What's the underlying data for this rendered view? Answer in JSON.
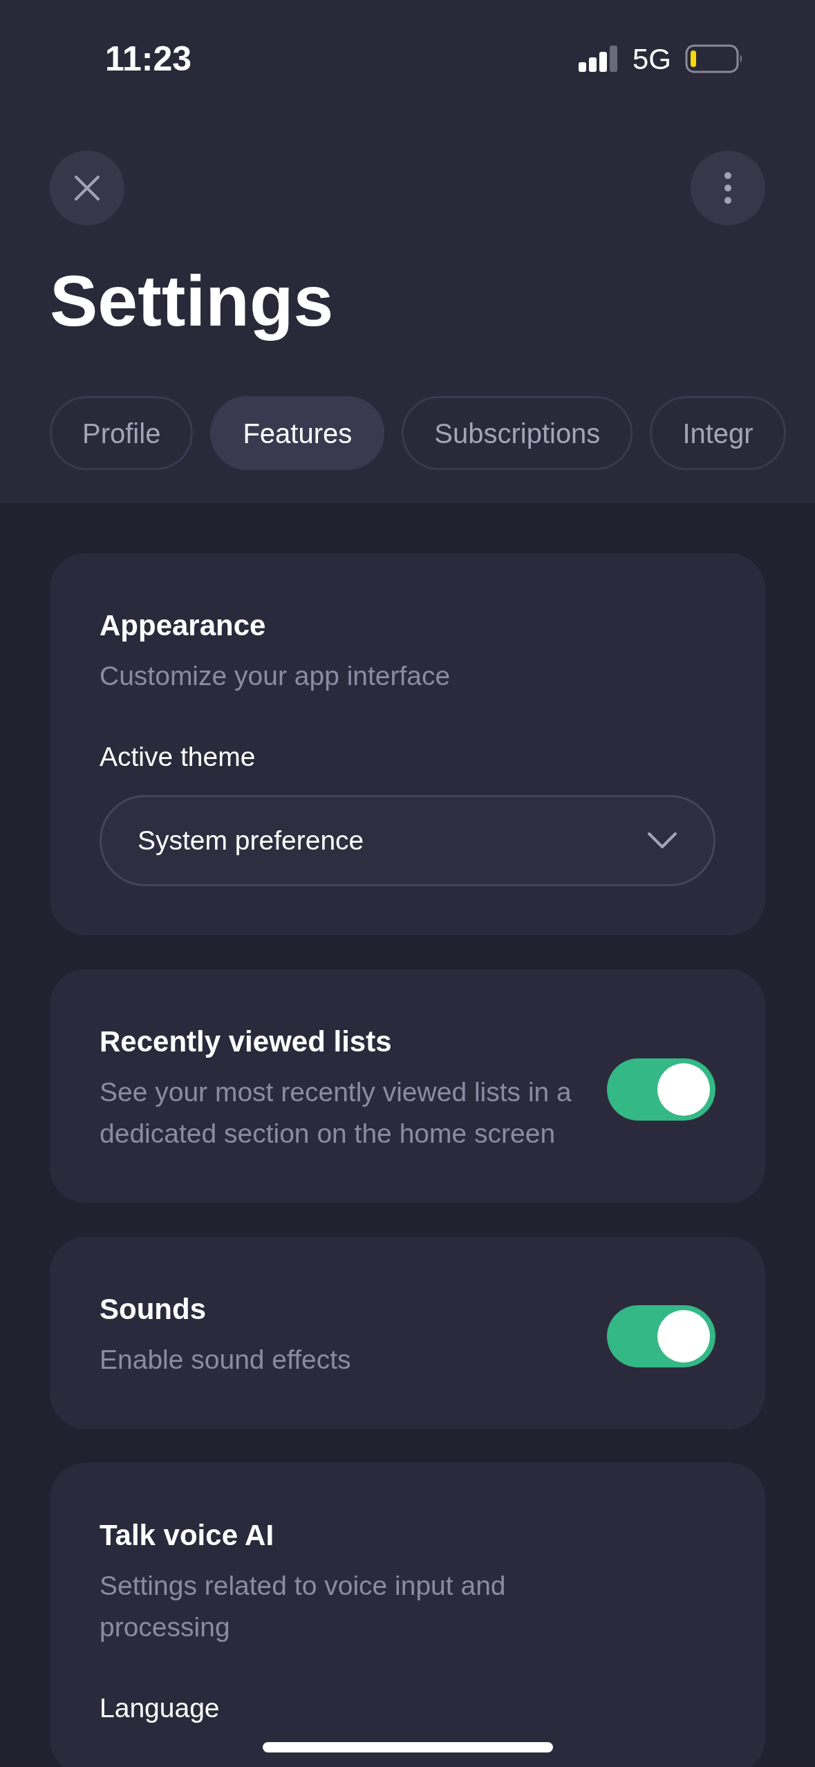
{
  "status_bar": {
    "time": "11:23",
    "network": "5G"
  },
  "header": {
    "title": "Settings"
  },
  "tabs": [
    {
      "label": "Profile",
      "selected": false
    },
    {
      "label": "Features",
      "selected": true
    },
    {
      "label": "Subscriptions",
      "selected": false
    },
    {
      "label": "Integr",
      "selected": false
    }
  ],
  "sections": [
    {
      "kind": "select",
      "title": "Appearance",
      "description": "Customize your app interface",
      "field_label": "Active theme",
      "value": "System preference"
    },
    {
      "kind": "toggle",
      "title": "Recently viewed lists",
      "description": "See your most recently viewed lists in a dedicated section on the home screen",
      "on": true
    },
    {
      "kind": "toggle",
      "title": "Sounds",
      "description": "Enable sound effects",
      "on": true
    },
    {
      "kind": "select",
      "title": "Talk voice AI",
      "description": "Settings related to voice input and processing",
      "field_label": "Language"
    }
  ]
}
